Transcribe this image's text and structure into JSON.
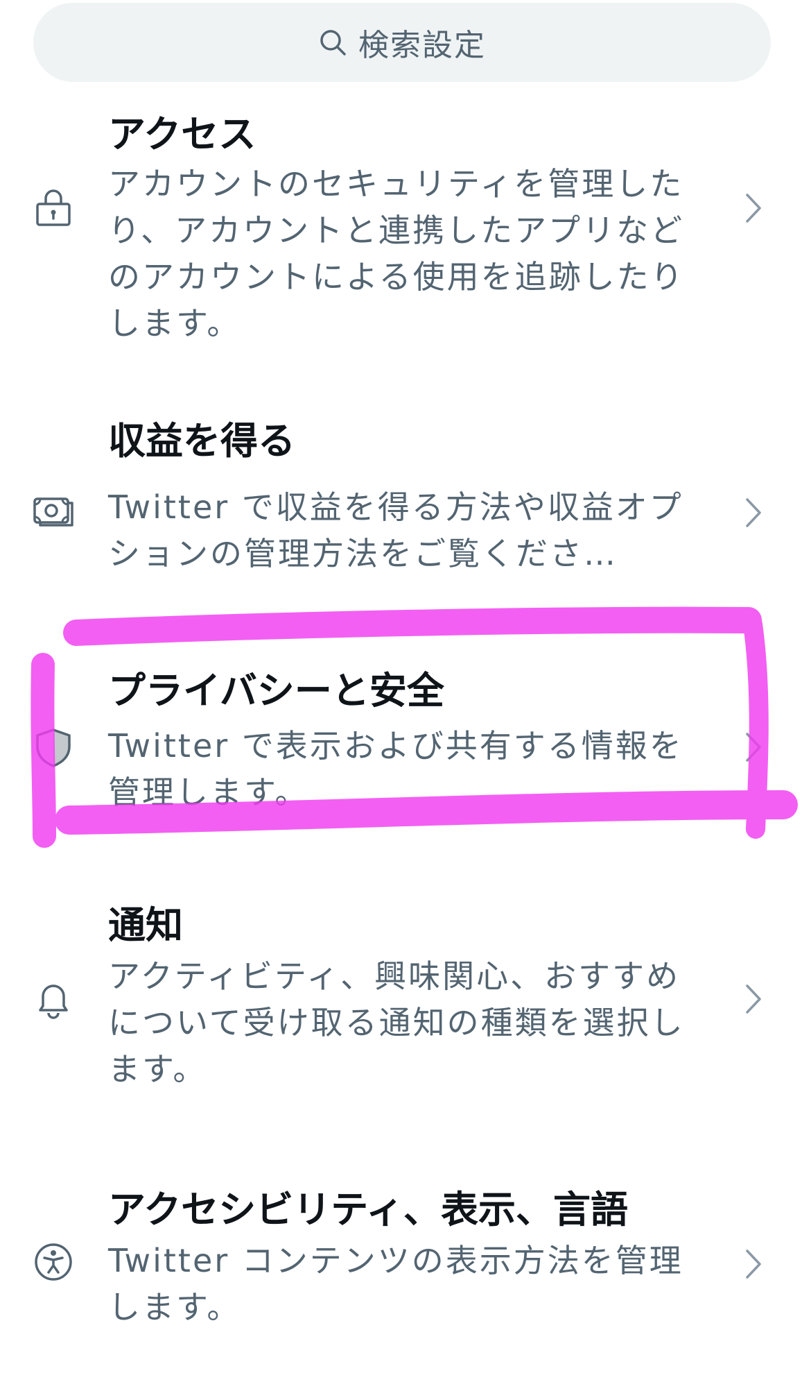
{
  "search": {
    "placeholder": "検索設定"
  },
  "settings": [
    {
      "title": "アクセス",
      "description": "アカウントのセキュリティを管理したり、アカウントと連携したアプリなどのアカウントによる使用を追跡したりします。",
      "icon": "lock-icon"
    },
    {
      "title": "収益を得る",
      "description": "Twitter で収益を得る方法や収益オプションの管理方法をご覧くださ…",
      "icon": "money-icon"
    },
    {
      "title": "プライバシーと安全",
      "description": "Twitter で表示および共有する情報を管理します。",
      "icon": "shield-icon"
    },
    {
      "title": "通知",
      "description": "アクティビティ、興味関心、おすすめについて受け取る通知の種類を選択します。",
      "icon": "bell-icon"
    },
    {
      "title": "アクセシビリティ、表示、言語",
      "description": "Twitter コンテンツの表示方法を管理します。",
      "icon": "accessibility-icon"
    }
  ],
  "colors": {
    "highlight": "#f03cf0",
    "search_bg": "#eff3f4",
    "secondary_text": "#536471",
    "primary_text": "#0f1419"
  }
}
